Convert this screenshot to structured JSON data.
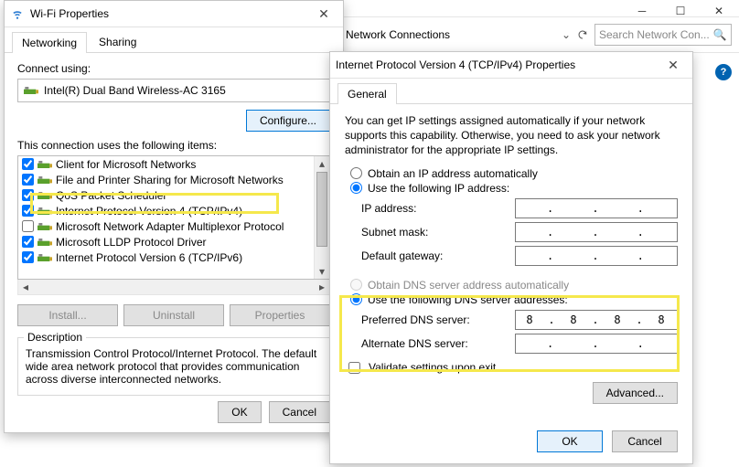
{
  "bg": {
    "breadcrumb": "Network Connections",
    "search_placeholder": "Search Network Con...",
    "help_glyph": "?"
  },
  "wifi": {
    "title": "Wi-Fi Properties",
    "tabs": {
      "networking": "Networking",
      "sharing": "Sharing"
    },
    "connect_using": "Connect using:",
    "adapter": "Intel(R) Dual Band Wireless-AC 3165",
    "configure": "Configure...",
    "items_label": "This connection uses the following items:",
    "items": [
      {
        "label": "Client for Microsoft Networks",
        "checked": true
      },
      {
        "label": "File and Printer Sharing for Microsoft Networks",
        "checked": true
      },
      {
        "label": "QoS Packet Scheduler",
        "checked": true
      },
      {
        "label": "Internet Protocol Version 4 (TCP/IPv4)",
        "checked": true
      },
      {
        "label": "Microsoft Network Adapter Multiplexor Protocol",
        "checked": false
      },
      {
        "label": "Microsoft LLDP Protocol Driver",
        "checked": true
      },
      {
        "label": "Internet Protocol Version 6 (TCP/IPv6)",
        "checked": true
      }
    ],
    "install": "Install...",
    "uninstall": "Uninstall",
    "properties": "Properties",
    "description_label": "Description",
    "description_text": "Transmission Control Protocol/Internet Protocol. The default wide area network protocol that provides communication across diverse interconnected networks.",
    "ok": "OK",
    "cancel": "Cancel"
  },
  "ipv4": {
    "title": "Internet Protocol Version 4 (TCP/IPv4) Properties",
    "tab_general": "General",
    "intro": "You can get IP settings assigned automatically if your network supports this capability. Otherwise, you need to ask your network administrator for the appropriate IP settings.",
    "r_auto_ip": "Obtain an IP address automatically",
    "r_static_ip": "Use the following IP address:",
    "ip_addr_lbl": "IP address:",
    "subnet_lbl": "Subnet mask:",
    "gw_lbl": "Default gateway:",
    "r_auto_dns": "Obtain DNS server address automatically",
    "r_static_dns": "Use the following DNS server addresses:",
    "pref_dns_lbl": "Preferred DNS server:",
    "alt_dns_lbl": "Alternate DNS server:",
    "pref_dns_val": [
      "8",
      "8",
      "8",
      "8"
    ],
    "alt_dns_val": [
      "",
      "",
      "",
      ""
    ],
    "validate": "Validate settings upon exit",
    "advanced": "Advanced...",
    "ok": "OK",
    "cancel": "Cancel"
  }
}
